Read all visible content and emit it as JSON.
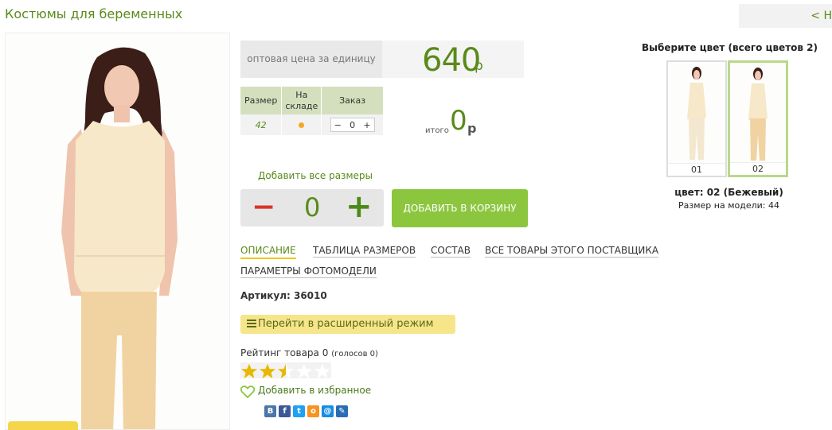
{
  "header": {
    "title": "Костюмы для беременных",
    "nav_link": "< Н"
  },
  "price": {
    "label": "оптовая цена за единицу",
    "value": "640",
    "currency": "р"
  },
  "size_table": {
    "headers": [
      "Размер",
      "На складе",
      "Заказ"
    ],
    "rows": [
      {
        "size": "42",
        "qty": "0"
      }
    ],
    "minus": "−",
    "plus": "+"
  },
  "total": {
    "label": "итого",
    "value": "0",
    "currency": "р"
  },
  "order": {
    "add_all_sizes": "Добавить все размеры",
    "qty": "0",
    "minus": "−",
    "plus": "+",
    "add_to_cart": "ДОБАВИТЬ В КОРЗИНУ"
  },
  "tabs": [
    "ОПИСАНИЕ",
    "ТАБЛИЦА РАЗМЕРОВ",
    "СОСТАВ",
    "ВСЕ ТОВАРЫ ЭТОГО ПОСТАВЩИКА",
    "ПАРАМЕТРЫ ФОТОМОДЕЛИ"
  ],
  "article": "Артикул: 36010",
  "advanced_mode": "Перейти в расширенный режим",
  "rating": {
    "label": "Рейтинг товара 0",
    "votes": "(голосов 0)",
    "stars_filled": 2.5,
    "stars_total": 5
  },
  "favorite": "Добавить в избранное",
  "social": [
    {
      "icon": "vk-icon",
      "glyph": "В",
      "color": "#4a76a8"
    },
    {
      "icon": "facebook-icon",
      "glyph": "f",
      "color": "#3b5998"
    },
    {
      "icon": "twitter-icon",
      "glyph": "t",
      "color": "#1da1f2"
    },
    {
      "icon": "odnoklassniki-icon",
      "glyph": "о",
      "color": "#f7931e"
    },
    {
      "icon": "mail-icon",
      "glyph": "@",
      "color": "#168de2"
    },
    {
      "icon": "livejournal-icon",
      "glyph": "✎",
      "color": "#2a6db5"
    }
  ],
  "colors": {
    "title": "Выберите цвет (всего цветов 2)",
    "options": [
      "01",
      "02"
    ],
    "selected": "цвет: 02 (Бежевый)",
    "model_size": "Размер на модели: 44"
  },
  "theme": {
    "accent": "#5a8a1a",
    "button": "#8cc63f",
    "highlight": "#f7e58a",
    "minus_red": "#d9342b"
  }
}
